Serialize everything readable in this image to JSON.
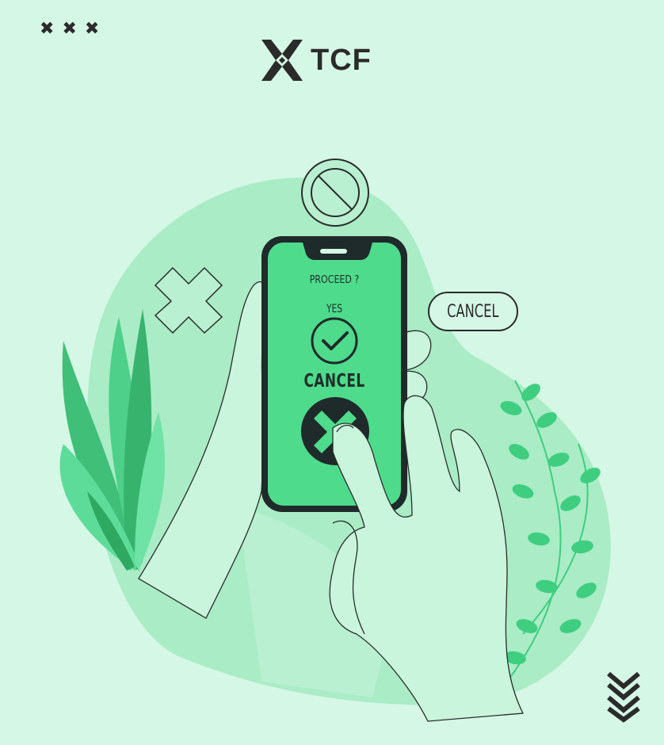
{
  "header": {
    "x_marks": [
      "✖",
      "✖",
      "✖"
    ],
    "logo_text": "TCF"
  },
  "phone": {
    "prompt": "PROCEED ?",
    "yes_label": "YES",
    "cancel_label": "CANCEL"
  },
  "floating": {
    "cancel_pill": "CANCEL"
  },
  "colors": {
    "background": "#d5f7e5",
    "blob": "#a9ecc6",
    "screen": "#4edb8c",
    "dark": "#1f2a2a",
    "leaf": "#3fce80"
  },
  "icons": {
    "prohibited": "prohibited-icon",
    "check": "check-icon",
    "cancel": "cancel-x-icon",
    "floating_x": "x-mark-icon",
    "scroll_down": "double-chevron-down-icon"
  }
}
